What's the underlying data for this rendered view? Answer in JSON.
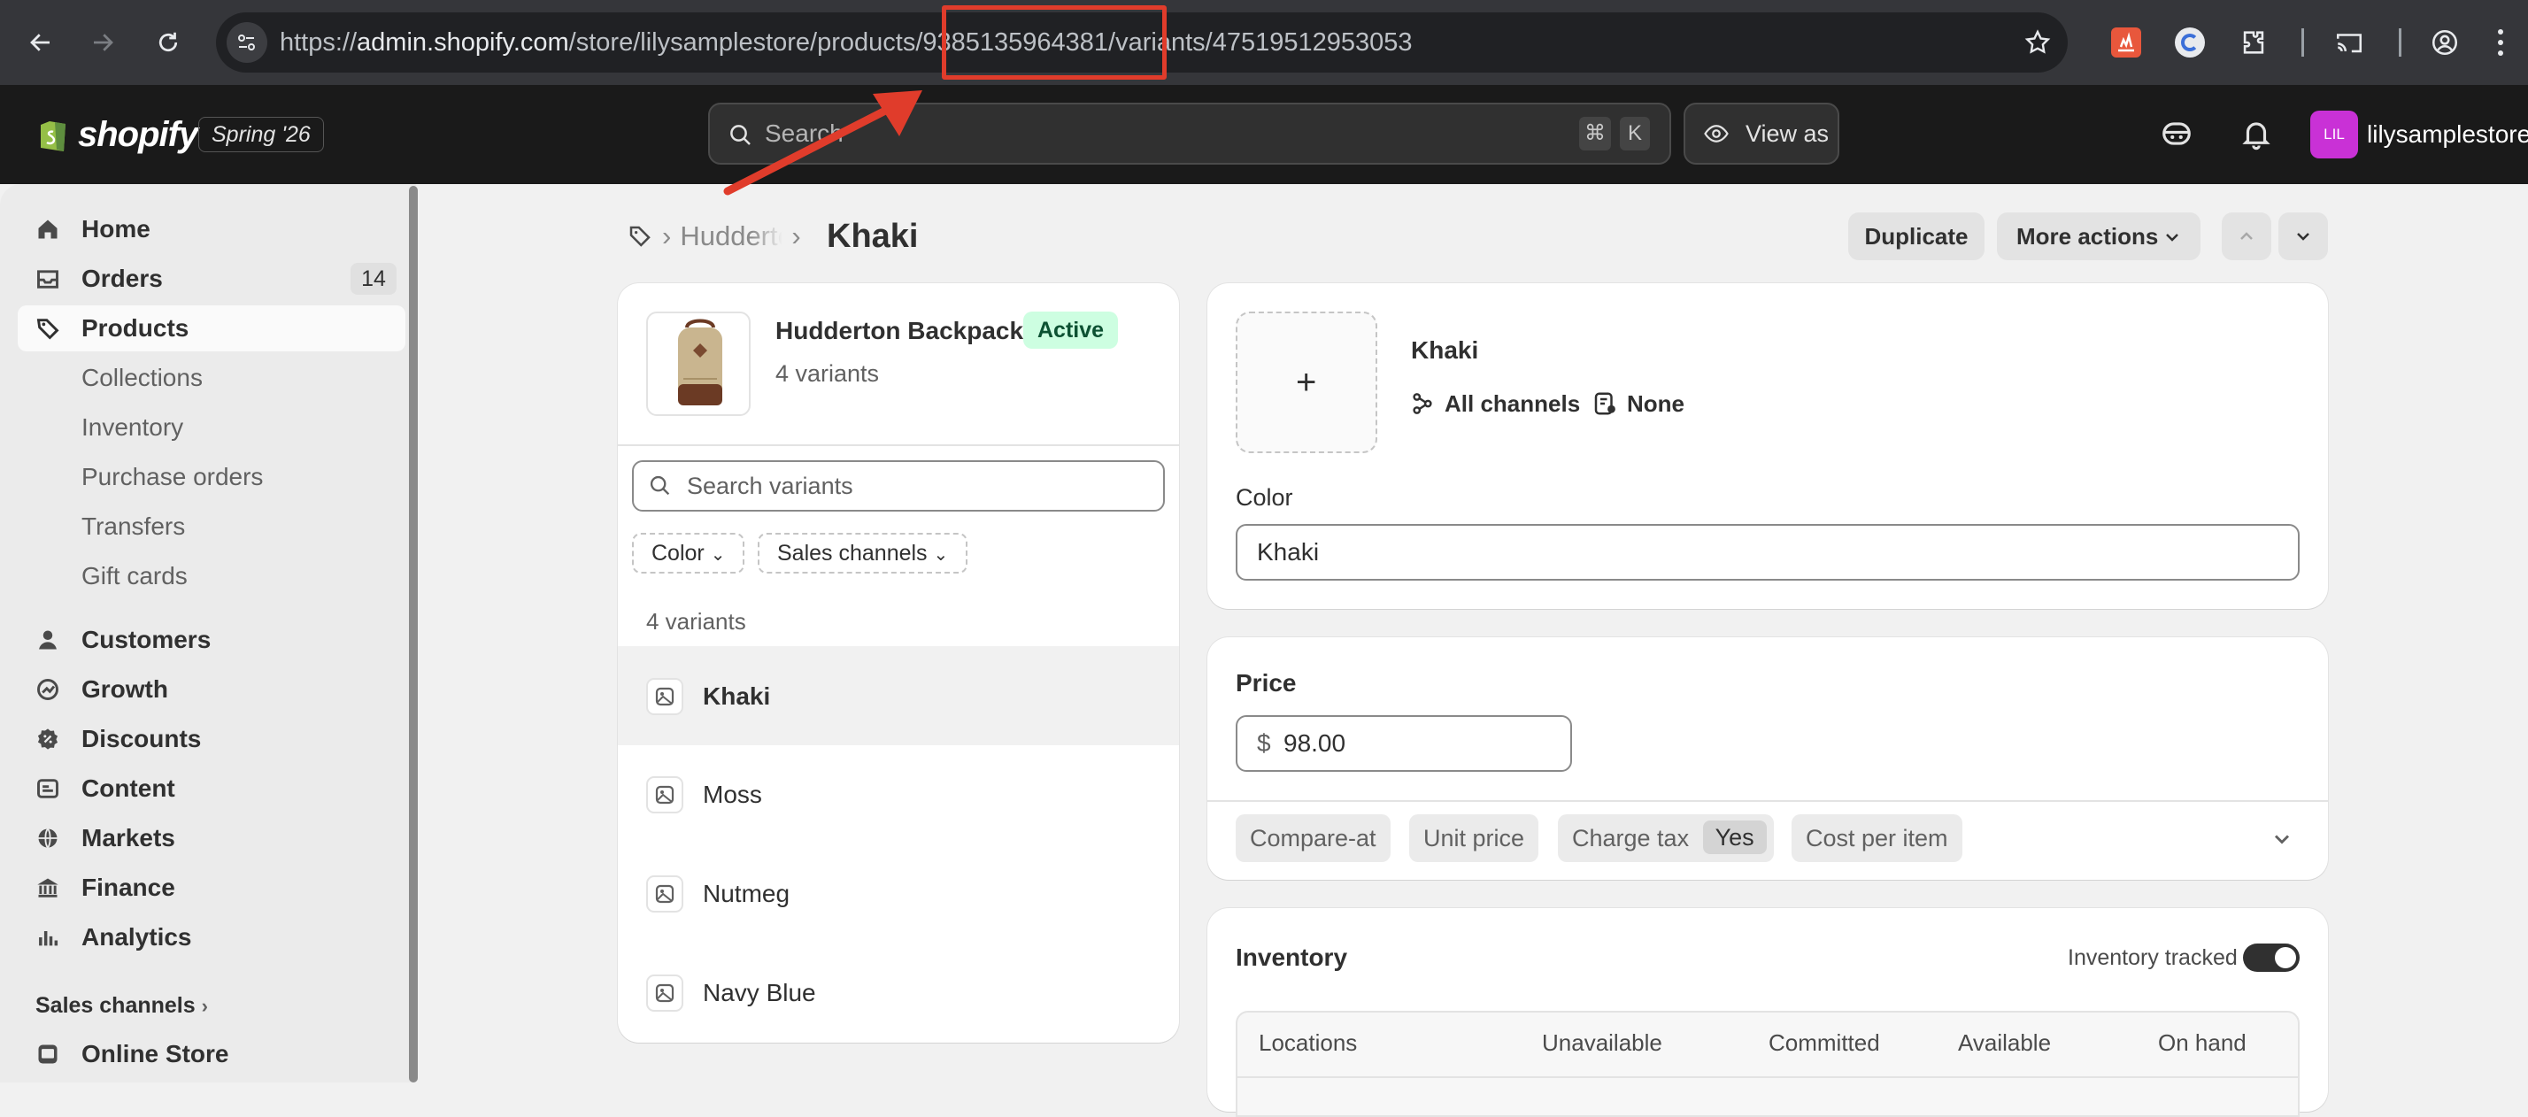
{
  "browser": {
    "url_prefix": "https://",
    "url_host": "admin.shopify.com",
    "url_path": "/store/lilysamplestore/products/9385135964381/variants/47519512953053"
  },
  "topbar": {
    "brand": "shopify",
    "season": "Spring '26",
    "search_placeholder": "Search",
    "shortcut_cmd": "⌘",
    "shortcut_key": "K",
    "view_as": "View as",
    "avatar_initials": "LIL",
    "store_name": "lilysamplestore"
  },
  "sidebar": {
    "items": [
      {
        "label": "Home",
        "icon": "home-icon"
      },
      {
        "label": "Orders",
        "icon": "inbox-icon",
        "count": "14"
      },
      {
        "label": "Products",
        "icon": "tag-icon"
      },
      {
        "label": "Collections"
      },
      {
        "label": "Inventory"
      },
      {
        "label": "Purchase orders"
      },
      {
        "label": "Transfers"
      },
      {
        "label": "Gift cards"
      },
      {
        "label": "Customers",
        "icon": "person-icon"
      },
      {
        "label": "Growth",
        "icon": "growth-icon"
      },
      {
        "label": "Discounts",
        "icon": "discount-icon"
      },
      {
        "label": "Content",
        "icon": "content-icon"
      },
      {
        "label": "Markets",
        "icon": "globe-icon"
      },
      {
        "label": "Finance",
        "icon": "bank-icon"
      },
      {
        "label": "Analytics",
        "icon": "chart-bars-icon"
      }
    ],
    "sales_channels_label": "Sales channels",
    "online_store": "Online Store"
  },
  "header": {
    "breadcrumb_product": "Hudderton Backpack",
    "title": "Khaki",
    "duplicate": "Duplicate",
    "more_actions": "More actions"
  },
  "product_card": {
    "name": "Hudderton Backpack",
    "status": "Active",
    "variant_count": "4 variants",
    "search_placeholder": "Search variants",
    "filter_color": "Color",
    "filter_channels": "Sales channels",
    "list_count": "4 variants",
    "variants": [
      "Khaki",
      "Moss",
      "Nutmeg",
      "Navy Blue"
    ]
  },
  "variant_card": {
    "name": "Khaki",
    "channels": "All channels",
    "catalogs": "None",
    "color_label": "Color",
    "color_value": "Khaki"
  },
  "price_card": {
    "label": "Price",
    "currency": "$",
    "value": "98.00",
    "chips": {
      "compare_at": "Compare-at",
      "unit_price": "Unit price",
      "charge_tax": "Charge tax",
      "charge_tax_value": "Yes",
      "cost_per_item": "Cost per item"
    }
  },
  "inventory_card": {
    "title": "Inventory",
    "tracked_label": "Inventory tracked",
    "tracked": true,
    "columns": [
      "Locations",
      "Unavailable",
      "Committed",
      "Available",
      "On hand"
    ]
  },
  "colors": {
    "accent_avatar": "#c931d6",
    "active_badge_bg": "#cdfee1",
    "active_badge_text": "#0c5132",
    "annotation_red": "#e03c2b"
  }
}
